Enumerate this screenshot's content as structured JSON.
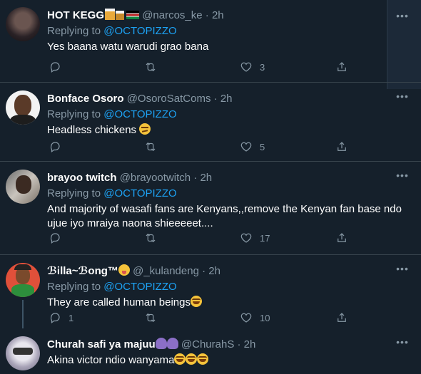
{
  "tweets": [
    {
      "name": "HOT KEGG",
      "handle": "@narcos_ke",
      "dot": "·",
      "time": "2h",
      "replying_prefix": "Replying to ",
      "replying_to": "@OCTOPIZZO",
      "text": "Yes baana watu warudi grao bana",
      "reply_count": "",
      "retweet_count": "",
      "like_count": "3"
    },
    {
      "name": "Bonface Osoro",
      "handle": "@OsoroSatComs",
      "dot": "·",
      "time": "2h",
      "replying_prefix": "Replying to ",
      "replying_to": "@OCTOPIZZO",
      "text": "Headless chickens",
      "reply_count": "",
      "retweet_count": "",
      "like_count": "5"
    },
    {
      "name": "brayoo twitch",
      "handle": "@brayootwitch",
      "dot": "·",
      "time": "2h",
      "replying_prefix": "Replying to ",
      "replying_to": "@OCTOPIZZO",
      "text": "And majority of wasafi fans are Kenyans,,remove the Kenyan fan base ndo ujue iyo mraiya naona shieeeeet....",
      "reply_count": "",
      "retweet_count": "",
      "like_count": "17"
    },
    {
      "name": "ℬilla~ℬong™",
      "handle": "@_kulandeng",
      "dot": "·",
      "time": "2h",
      "replying_prefix": "Replying to ",
      "replying_to": "@OCTOPIZZO",
      "text": "They are called human beings",
      "reply_count": "1",
      "retweet_count": "",
      "like_count": "10"
    },
    {
      "name": "Churah safi ya majuu",
      "handle": "@ChurahS",
      "dot": "·",
      "time": "2h",
      "text": "Akina victor ndio wanyama"
    }
  ],
  "icons": {
    "more": "more-horizontal-icon",
    "reply": "reply-icon",
    "retweet": "retweet-icon",
    "like": "heart-icon",
    "share": "share-icon"
  },
  "colors": {
    "background": "#15202b",
    "accent": "#1da1f2",
    "muted": "#8899a6",
    "divider": "#38444d"
  }
}
